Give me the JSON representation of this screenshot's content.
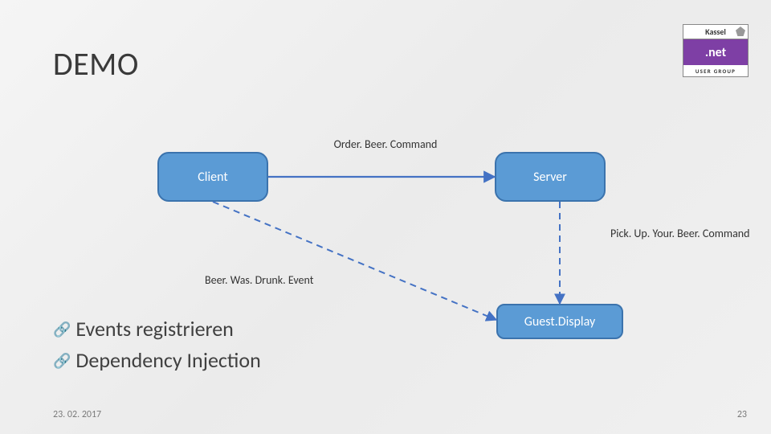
{
  "title": "DEMO",
  "logo": {
    "top": "Kassel",
    "mid": ".net",
    "bot": "USER GROUP"
  },
  "nodes": {
    "client": "Client",
    "server": "Server",
    "guest": "Guest.Display"
  },
  "labels": {
    "order": "Order. Beer. Command",
    "pickup": "Pick. Up. Your. Beer. Command",
    "drunk": "Beer. Was. Drunk. Event"
  },
  "bullets": {
    "item1": "Events registrieren",
    "item2": "Dependency Injection"
  },
  "footer": {
    "date": "23. 02. 2017",
    "page": "23"
  },
  "colors": {
    "node_fill": "#5b9bd5",
    "node_border": "#3b73ad",
    "arrow": "#4472c4",
    "dash": "#4472c4"
  }
}
